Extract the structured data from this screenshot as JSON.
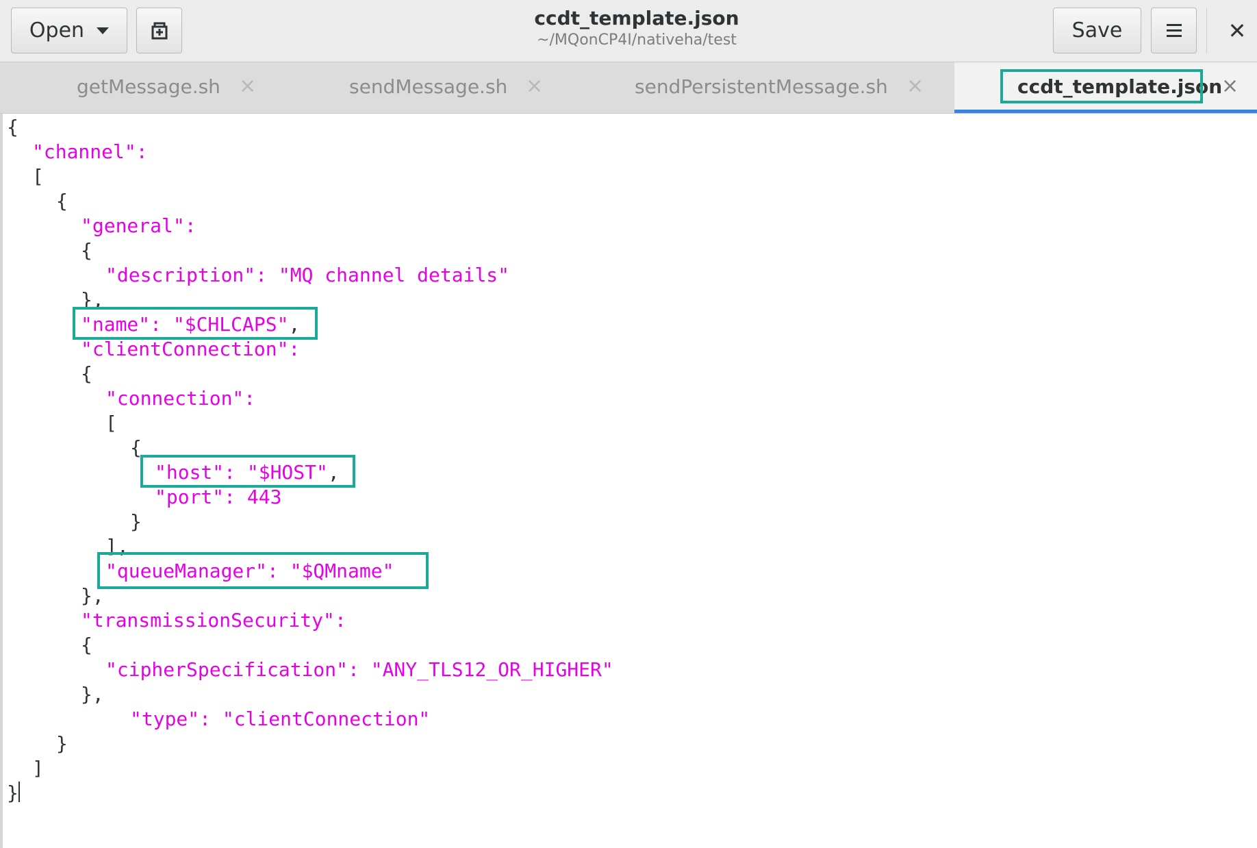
{
  "header": {
    "open_label": "Open",
    "save_label": "Save",
    "title": "ccdt_template.json",
    "subtitle": "~/MQonCP4I/nativeha/test"
  },
  "tabs": [
    {
      "label": "getMessage.sh",
      "active": false
    },
    {
      "label": "sendMessage.sh",
      "active": false
    },
    {
      "label": "sendPersistentMessage.sh",
      "active": false
    },
    {
      "label": "ccdt_template.json",
      "active": true
    }
  ],
  "code": {
    "l01": "{",
    "l02": "\"channel\":",
    "l03": "[",
    "l04": "{",
    "l05": "\"general\":",
    "l06": "{",
    "l07": "\"description\": \"MQ channel details\"",
    "l08": "},",
    "l09": "\"name\": \"$CHLCAPS\"",
    "l09p": ",",
    "l10": "\"clientConnection\":",
    "l11": "{",
    "l12": "\"connection\":",
    "l13": "[",
    "l14": "{",
    "l15": "\"host\": \"$HOST\"",
    "l15p": ",",
    "l16": "\"port\": 443",
    "l17": "}",
    "l18": "],",
    "l19": "\"queueManager\": \"$QMname\"",
    "l20": "},",
    "l21": "\"transmissionSecurity\":",
    "l22": "{",
    "l23": "\"cipherSpecification\": \"ANY_TLS12_OR_HIGHER\"",
    "l24": "},",
    "l25": "\"type\": \"clientConnection\"",
    "l26": "}",
    "l27": "]",
    "l28": "}"
  },
  "colors": {
    "string_key": "#e600e6",
    "highlight": "#1aaa97",
    "active_tab_underline": "#3584e4"
  }
}
